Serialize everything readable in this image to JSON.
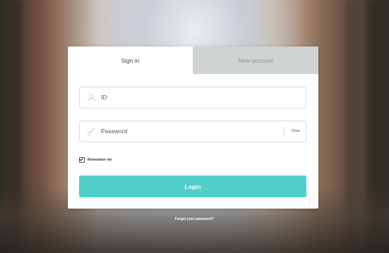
{
  "tabs": {
    "signin": "Sign in",
    "new_account": "New account"
  },
  "fields": {
    "id_placeholder": "ID",
    "password_placeholder": "Password",
    "show_label": "Show"
  },
  "remember": {
    "label": "Remember me",
    "checked": true
  },
  "login_label": "Login",
  "forgot_label": "Forgot your password?",
  "colors": {
    "accent": "#4fcfc7",
    "inactive_tab": "#cfd3d3"
  },
  "icons": {
    "id_field": "user-icon",
    "password_field": "key-icon"
  }
}
